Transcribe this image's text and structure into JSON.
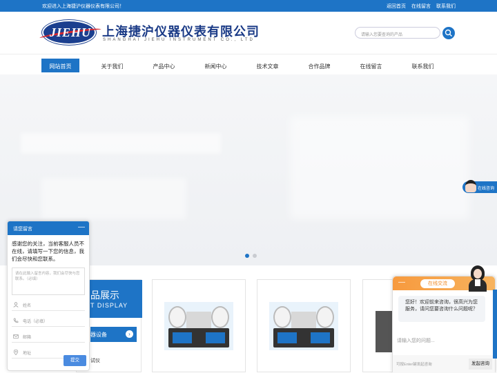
{
  "topbar": {
    "welcome": "欢迎进入上海捷沪仪器仪表有限公司！",
    "links": [
      "返回首页",
      "在线留言",
      "联系我们"
    ]
  },
  "header": {
    "logo_text": "JIEHU",
    "company_cn": "上海捷沪仪器仪表有限公司",
    "company_en": "SHANGHAI JIEHU INSTRUMENT CO., LTD",
    "search_placeholder": "请输入您要查询的产品"
  },
  "nav": {
    "items": [
      "网站首页",
      "关于我们",
      "产品中心",
      "新闻中心",
      "技术文章",
      "合作品牌",
      "在线留言",
      "联系我们"
    ],
    "active": "网站首页"
  },
  "float_consult": {
    "label": "在线咨询"
  },
  "products": {
    "section_cn": "品展示",
    "section_en": "T DISPLAY",
    "selected_category": "器设备",
    "sub_item_1": "试仪",
    "sub_item_2": "试仪"
  },
  "message_panel": {
    "title": "请您留言",
    "intro": "感谢您的关注，当前客服人员不在线，请填写一下您的信息，我们会尽快和您联系。",
    "textarea_placeholder": "请在此输入留言内容，我们会尽快与您联系。（必填）",
    "fields": {
      "name": "姓名",
      "phone": "电话（必填）",
      "email": "邮箱",
      "address": "地址"
    },
    "submit": "提交"
  },
  "chat": {
    "tab": "在线交流",
    "greeting": "您好！欢迎前来咨询，很高兴为您服务，请问您要咨询什么问题呢？",
    "input_placeholder": "请输入您的问题...",
    "hint": "可按Enter键发起咨询",
    "send": "发起咨询"
  },
  "colors": {
    "primary": "#1e74c6",
    "chat_orange": "#f79a3e",
    "logo_red": "#d9262d"
  },
  "carousel": {
    "slides": 2,
    "active_slide": 1
  }
}
